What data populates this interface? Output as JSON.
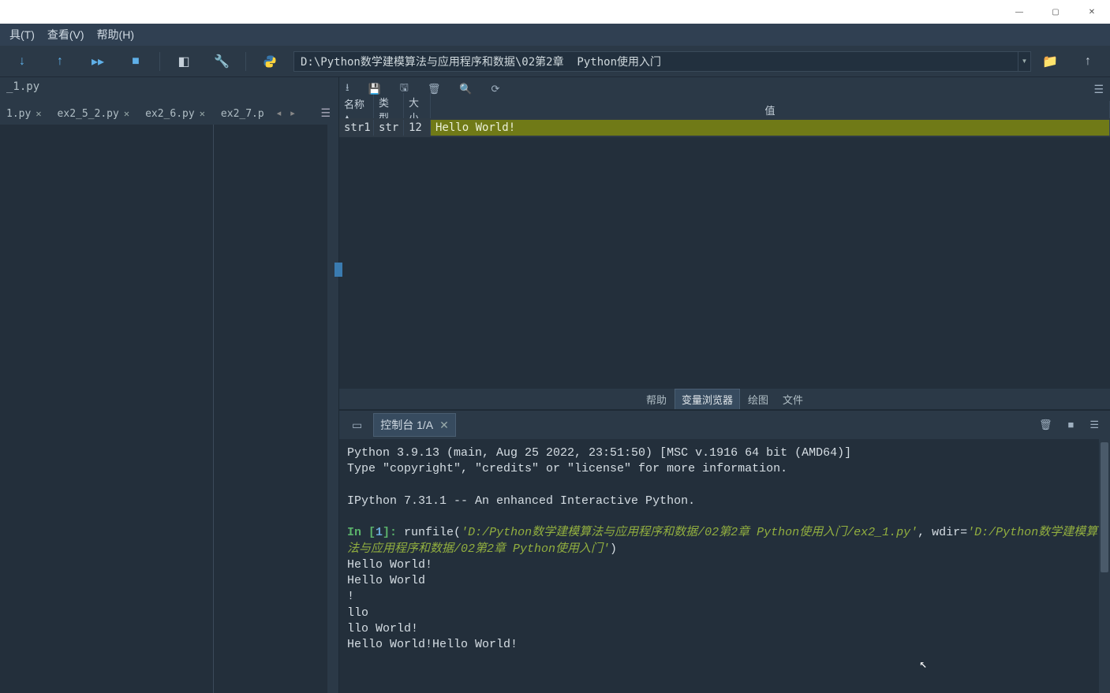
{
  "titlebar": {
    "minimize": "—",
    "maximize": "▢",
    "close": "✕"
  },
  "menubar": {
    "items": [
      "具(T)",
      "查看(V)",
      "帮助(H)"
    ]
  },
  "toolbar": {
    "path": "D:\\Python数学建模算法与应用程序和数据\\02第2章  Python使用入门"
  },
  "editor": {
    "header_filename": "_1.py",
    "tabs": [
      {
        "label": "1.py"
      },
      {
        "label": "ex2_5_2.py"
      },
      {
        "label": "ex2_6.py"
      },
      {
        "label": "ex2_7.p"
      }
    ]
  },
  "var_explorer": {
    "headers": {
      "name": "名称",
      "type": "类型",
      "size": "大小",
      "value": "值"
    },
    "rows": [
      {
        "name": "str1",
        "type": "str",
        "size": "12",
        "value": "Hello World!"
      }
    ]
  },
  "pane_tabs": [
    "帮助",
    "变量浏览器",
    "绘图",
    "文件"
  ],
  "pane_tab_active": 1,
  "console": {
    "tab_label": "控制台 1/A",
    "header_line1": "Python 3.9.13 (main, Aug 25 2022, 23:51:50) [MSC v.1916 64 bit (AMD64)]",
    "header_line2": "Type \"copyright\", \"credits\" or \"license\" for more information.",
    "header_line3": "IPython 7.31.1 -- An enhanced Interactive Python.",
    "prompt_in": "In [",
    "prompt_num": "1",
    "prompt_close": "]: ",
    "run_cmd_pre": "runfile(",
    "run_path1": "'D:/Python数学建模算法与应用程序和数据/02第2章  Python使用入门/ex2_1.py'",
    "run_cmd_mid": ", wdir=",
    "run_path2": "'D:/Python数学建模算法与应用程序和数据/02第2章  Python使用入门'",
    "run_cmd_post": ")",
    "out_lines": [
      "Hello World!",
      "Hello World",
      "!",
      "llo",
      "llo World!",
      "Hello World!Hello World!"
    ]
  }
}
